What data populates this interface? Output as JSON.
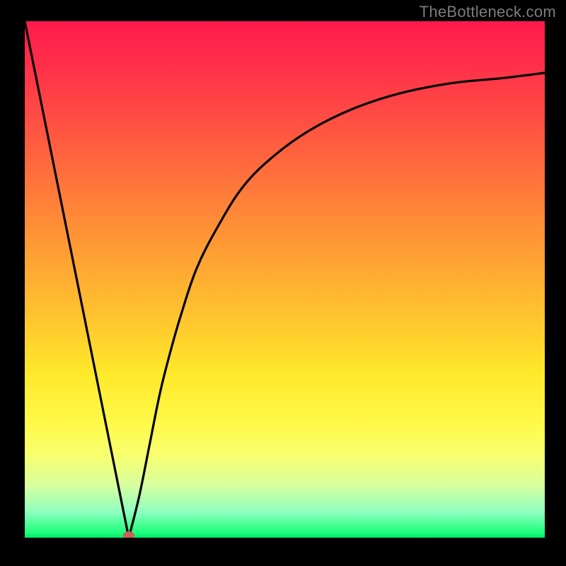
{
  "watermark": "TheBottleneck.com",
  "colors": {
    "frame_bg": "#000000",
    "marker": "#c9605a",
    "curve": "#000000",
    "gradient_top": "#ff1a4d",
    "gradient_bottom": "#00e86b",
    "watermark_text": "#7d7d7d"
  },
  "chart_data": {
    "type": "line",
    "title": "",
    "xlabel": "",
    "ylabel": "",
    "xlim": [
      0,
      100
    ],
    "ylim": [
      0,
      100
    ],
    "grid": false,
    "legend": false,
    "annotations": [
      {
        "kind": "marker",
        "x": 20,
        "y": 0,
        "shape": "oval",
        "color": "#c9605a"
      }
    ],
    "series": [
      {
        "name": "bottleneck-curve",
        "color": "#000000",
        "x": [
          0,
          4,
          8,
          12,
          16,
          18,
          20,
          22,
          24,
          26,
          28,
          30,
          33,
          37,
          42,
          48,
          55,
          63,
          72,
          82,
          92,
          100
        ],
        "y": [
          100,
          80,
          60,
          40,
          20,
          10,
          0,
          8,
          18,
          28,
          36,
          43,
          52,
          60,
          68,
          74,
          79,
          83,
          86,
          88,
          89,
          90
        ]
      }
    ],
    "background_gradient": {
      "direction": "vertical",
      "top_meaning": "high-bottleneck",
      "bottom_meaning": "no-bottleneck",
      "stops": [
        {
          "pos": 0.0,
          "color": "#ff1a4d"
        },
        {
          "pos": 0.5,
          "color": "#ffc62e"
        },
        {
          "pos": 0.8,
          "color": "#fff94a"
        },
        {
          "pos": 1.0,
          "color": "#00e86b"
        }
      ]
    }
  }
}
